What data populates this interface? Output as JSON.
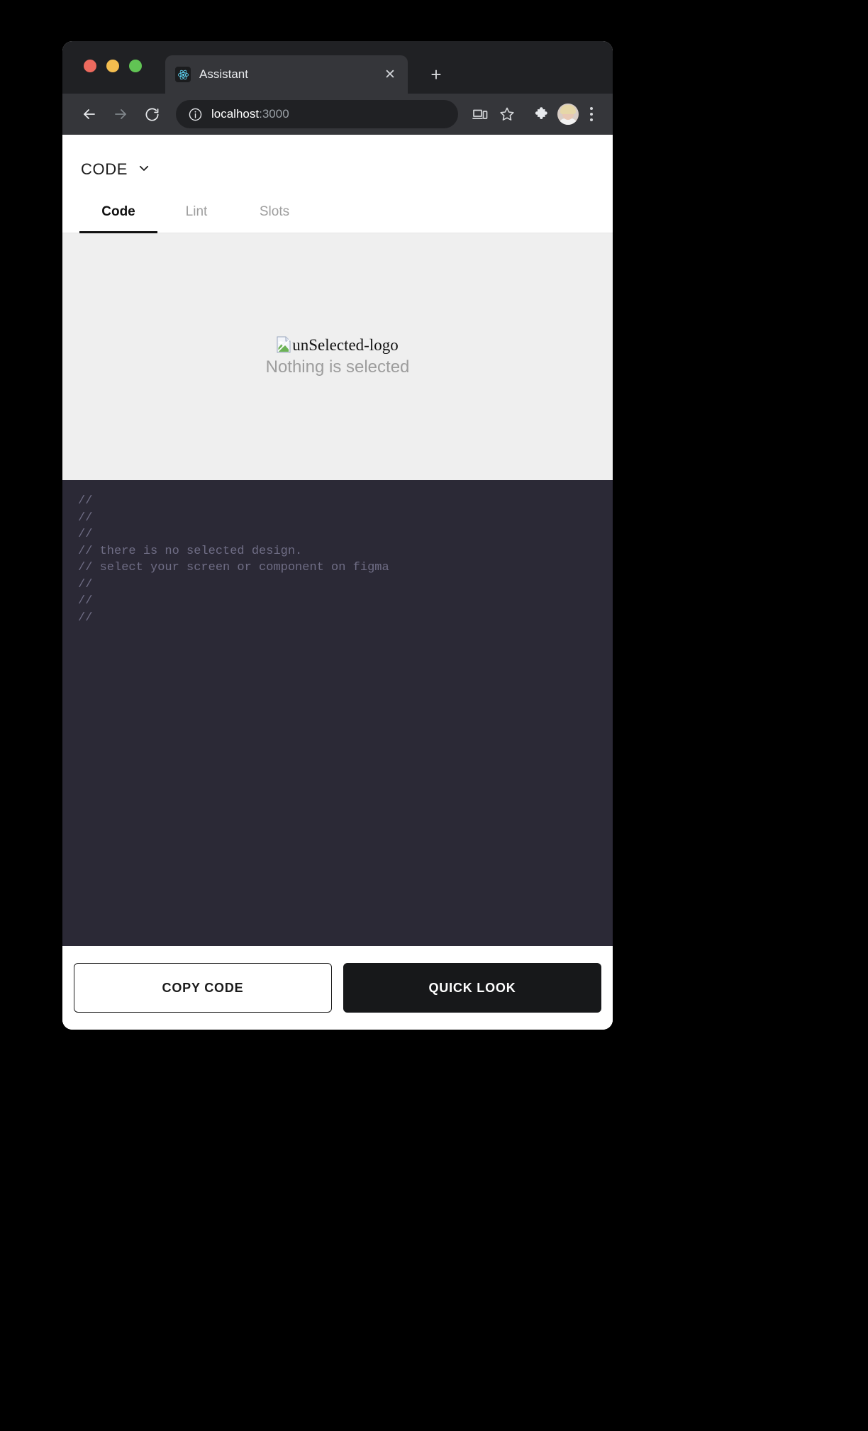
{
  "browser": {
    "traffic_lights": [
      "close",
      "minimize",
      "maximize"
    ],
    "tab": {
      "title": "Assistant",
      "favicon": "react-logo-icon",
      "close_label": "✕"
    },
    "new_tab_label": "+",
    "toolbar": {
      "back_icon": "arrow-left-icon",
      "forward_icon": "arrow-right-icon",
      "reload_icon": "reload-icon",
      "site_info_icon": "info-circle-icon",
      "url_host": "localhost",
      "url_port": ":3000",
      "cast_icon": "cast-device-icon",
      "bookmark_icon": "star-icon",
      "extensions_icon": "puzzle-piece-icon",
      "profile_icon": "profile-avatar",
      "menu_icon": "three-dots-icon"
    }
  },
  "app": {
    "header": {
      "mode_label": "CODE",
      "chevron_icon": "chevron-down-icon"
    },
    "tabs": [
      {
        "label": "Code",
        "active": true
      },
      {
        "label": "Lint",
        "active": false
      },
      {
        "label": "Slots",
        "active": false
      }
    ],
    "preview": {
      "image_alt": "unSelected-logo",
      "image_icon": "broken-image-icon",
      "empty_text": "Nothing is selected"
    },
    "code": {
      "lines": [
        "//",
        "//",
        "//",
        "// there is no selected design.",
        "// select your screen or component on figma",
        "//",
        "//",
        "//"
      ]
    },
    "actions": {
      "copy_label": "COPY CODE",
      "quick_look_label": "QUICK LOOK"
    }
  },
  "colors": {
    "page_background": "#000000",
    "tabstrip": "#202124",
    "toolbar": "#35363a",
    "preview_pane": "#efefef",
    "code_pane": "#2b2936",
    "code_text": "#6f6d85",
    "accent_dark": "#17181a",
    "traffic_red": "#ed6a5e",
    "traffic_yellow": "#f4bd4f",
    "traffic_green": "#61c454"
  }
}
